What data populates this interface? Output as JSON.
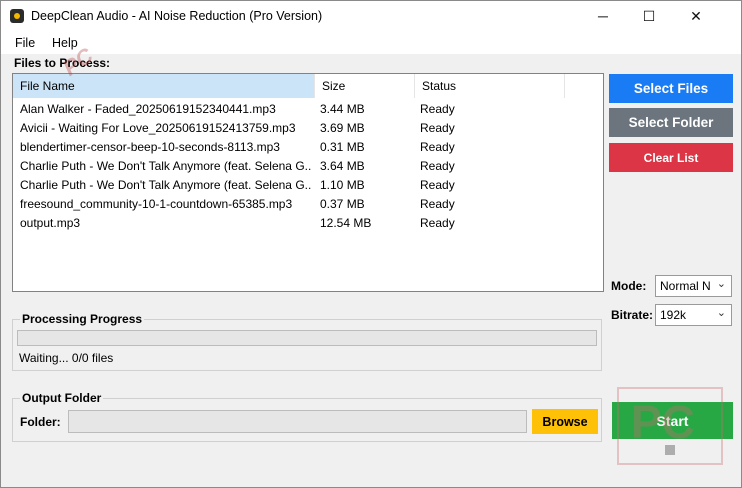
{
  "window": {
    "title": "DeepClean Audio - AI Noise Reduction (Pro Version)",
    "controls": {
      "minimize": "─",
      "maximize": "☐",
      "close": "✕"
    }
  },
  "menu": {
    "file": "File",
    "help": "Help"
  },
  "files_section": {
    "label": "Files to Process:",
    "columns": {
      "name": "File Name",
      "size": "Size",
      "status": "Status"
    },
    "rows": [
      {
        "name": "Alan Walker - Faded_20250619152340441.mp3",
        "size": "3.44 MB",
        "status": "Ready"
      },
      {
        "name": "Avicii - Waiting For Love_20250619152413759.mp3",
        "size": "3.69 MB",
        "status": "Ready"
      },
      {
        "name": "blendertimer-censor-beep-10-seconds-8113.mp3",
        "size": "0.31 MB",
        "status": "Ready"
      },
      {
        "name": "Charlie Puth - We Don't Talk Anymore (feat. Selena G...",
        "size": "3.64 MB",
        "status": "Ready"
      },
      {
        "name": "Charlie Puth - We Don't Talk Anymore (feat. Selena G...",
        "size": "1.10 MB",
        "status": "Ready"
      },
      {
        "name": "freesound_community-10-1-countdown-65385.mp3",
        "size": "0.37 MB",
        "status": "Ready"
      },
      {
        "name": "output.mp3",
        "size": "12.54 MB",
        "status": "Ready"
      }
    ]
  },
  "buttons": {
    "select_files": "Select Files",
    "select_folder": "Select Folder",
    "clear_list": "Clear List",
    "browse": "Browse",
    "start": "Start"
  },
  "settings": {
    "mode_label": "Mode:",
    "mode_value": "Normal N",
    "bitrate_label": "Bitrate:",
    "bitrate_value": "192k"
  },
  "progress": {
    "label": "Processing Progress",
    "fraction": 0,
    "status_text": "Waiting... 0/0 files"
  },
  "output": {
    "label": "Output Folder",
    "folder_label": "Folder:",
    "folder_value": ""
  },
  "colors": {
    "select_files": "#1a7cf5",
    "select_folder": "#6c757d",
    "clear_list": "#dc3545",
    "browse": "#ffc107",
    "start": "#28a745",
    "header_highlight": "#cce4f7"
  },
  "watermark": {
    "text": "PC"
  }
}
